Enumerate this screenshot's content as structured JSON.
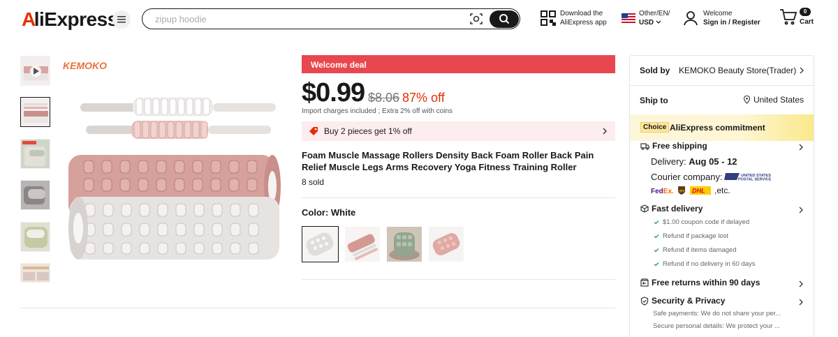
{
  "header": {
    "logo_text": "AliExpress",
    "search_placeholder": "zipup hoodie",
    "app_line1": "Download the",
    "app_line2": "AliExpress app",
    "lang_line1": "Other/EN/",
    "lang_line2": "USD",
    "welcome_line1": "Welcome",
    "welcome_line2": "Sign in / Register",
    "cart_count": "0",
    "cart_label": "Cart"
  },
  "product": {
    "brand": "KEMOKO",
    "deal_label": "Welcome deal",
    "price": "$0.99",
    "old_price": "$8.06",
    "discount": "87% off",
    "import_note": "Import charges included ; Extra 2% off with coins",
    "coupon": "Buy 2 pieces get 1% off",
    "title": "Foam Muscle Massage Rollers Density Back Foam Roller Back Pain Relief Muscle Legs Arms Recovery Yoga Fitness Training Roller",
    "sold": "8 sold",
    "color_label": "Color: White",
    "variants": [
      "white",
      "pink-set",
      "green",
      "pink"
    ]
  },
  "panel": {
    "sold_by_label": "Sold by",
    "seller": "KEMOKO Beauty Store(Trader)",
    "ship_to_label": "Ship to",
    "ship_to": "United States",
    "choice_tag": "Choice",
    "commitment": "AliExpress commitment",
    "free_shipping": "Free shipping",
    "delivery_prefix": "Delivery: ",
    "delivery_dates": "Aug 05 - 12",
    "courier_label": "Courier company:",
    "courier_etc": ",etc.",
    "fast_delivery": "Fast delivery",
    "fast_items": [
      "$1.00 coupon code if delayed",
      "Refund if package lost",
      "Refund if items damaged",
      "Refund if no delivery in 60 days"
    ],
    "free_returns": "Free returns within 90 days",
    "security": "Security & Privacy",
    "security_items": [
      "Safe payments: We do not share your per...",
      "Secure personal details: We protect your ..."
    ]
  },
  "colors": {
    "brand_red": "#e62e04",
    "deal_red": "#e9474f",
    "brand_orange": "#e9733b"
  }
}
